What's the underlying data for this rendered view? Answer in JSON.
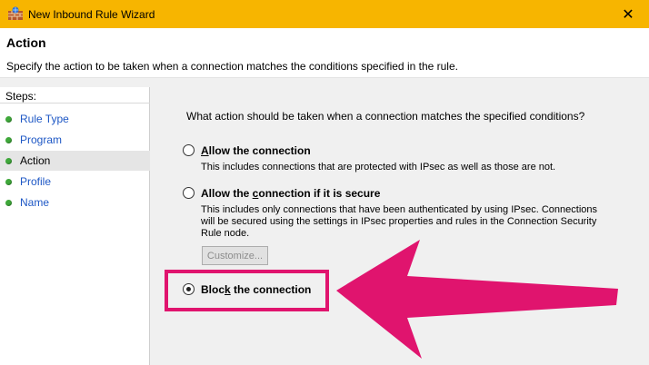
{
  "window": {
    "title": "New Inbound Rule Wizard",
    "close_glyph": "✕"
  },
  "header": {
    "title": "Action",
    "subtitle": "Specify the action to be taken when a connection matches the conditions specified in the rule."
  },
  "steps": {
    "title": "Steps:",
    "items": [
      {
        "label": "Rule Type"
      },
      {
        "label": "Program"
      },
      {
        "label": "Action"
      },
      {
        "label": "Profile"
      },
      {
        "label": "Name"
      }
    ],
    "active_index": 2
  },
  "content": {
    "question": "What action should be taken when a connection matches the specified conditions?",
    "options": [
      {
        "label_underlined": "A",
        "label_rest": "llow the connection",
        "description": "This includes connections that are protected with IPsec as well as those are not.",
        "checked": false
      },
      {
        "label_before": "Allow the ",
        "label_underlined": "c",
        "label_rest": "onnection if it is secure",
        "description": "This includes only connections that have been authenticated by using IPsec.  Connections will be secured using the settings in IPsec properties and rules in the Connection Security Rule node.",
        "checked": false
      },
      {
        "label_before": "Bloc",
        "label_underlined": "k",
        "label_rest": " the connection",
        "checked": true
      }
    ],
    "customize_button": "Customize..."
  },
  "annotation": {
    "color": "#e0146e",
    "icon": "arrow-left-icon"
  }
}
